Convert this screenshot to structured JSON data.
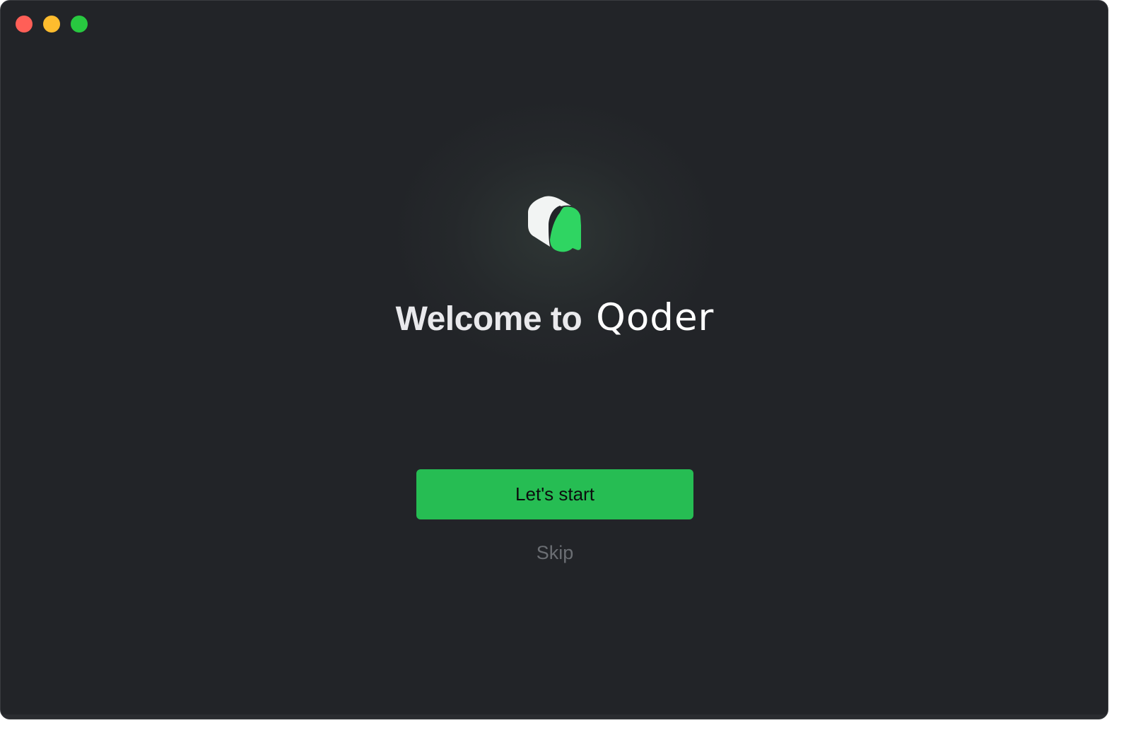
{
  "window": {
    "controls": [
      {
        "name": "close-button",
        "color": "#ff5f57"
      },
      {
        "name": "minimize-button",
        "color": "#febc2e"
      },
      {
        "name": "zoom-button",
        "color": "#28c840"
      }
    ]
  },
  "hero": {
    "logo_icon": "qoder-logo-icon",
    "welcome_text": "Welcome to",
    "brand_name": "Qoder"
  },
  "actions": {
    "start_label": "Let's start",
    "skip_label": "Skip"
  },
  "colors": {
    "background": "#222428",
    "accent": "#26bd53",
    "logo_green": "#2fd562",
    "logo_white": "#f2f4f3",
    "muted_text": "#6b6e73"
  }
}
